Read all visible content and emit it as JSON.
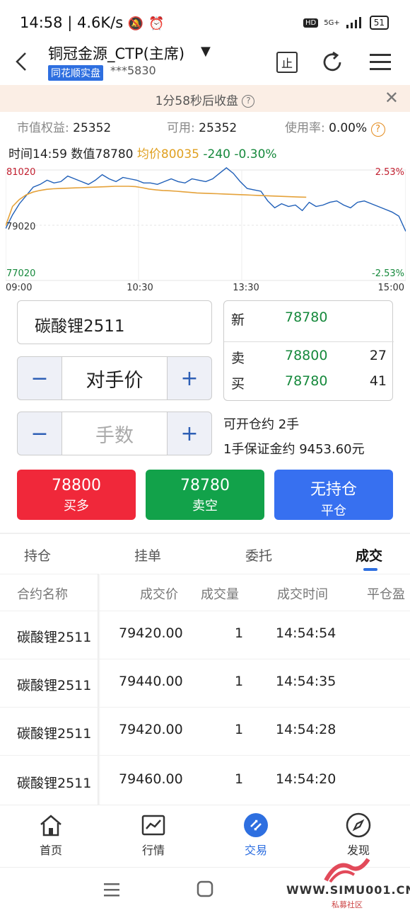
{
  "status_bar": {
    "time": "14:58",
    "speed": "4.6K/s",
    "network": "5G+",
    "hd": "HD",
    "battery": "51"
  },
  "header": {
    "title": "铜冠金源_CTP(主席)",
    "broker_badge": "同花顺实盘",
    "account": "***5830",
    "stop_label": "止"
  },
  "notice": {
    "text": "1分58秒后收盘"
  },
  "account_summary": {
    "equity_label": "市值权益:",
    "equity_value": "25352",
    "available_label": "可用:",
    "available_value": "25352",
    "usage_label": "使用率:",
    "usage_value": "0.00%"
  },
  "chart_info": {
    "time": "时间14:59",
    "value": "数值78780",
    "avg": "均价80035",
    "change": "-240",
    "change_pct": "-0.30%"
  },
  "chart_data": {
    "type": "line",
    "y_ticks_left": [
      "81020",
      "79020",
      "77020"
    ],
    "y_ticks_right": [
      "2.53%",
      "",
      "-2.53%"
    ],
    "x_ticks": [
      "09:00",
      "10:30",
      "13:30",
      "15:00"
    ],
    "ylim": [
      77020,
      81020
    ],
    "series": [
      {
        "values": [
          78900,
          79400,
          79800,
          80100,
          80400,
          80500,
          80650,
          80550,
          80600,
          80800,
          80700,
          80600,
          80500,
          80650,
          80850,
          80700,
          80600,
          80750,
          80700,
          80650,
          80550,
          80550,
          80500,
          80600,
          80700,
          80600,
          80550,
          80700,
          80650,
          80600,
          80700,
          80900,
          81100,
          80900,
          80600,
          80350,
          80300,
          80250,
          79900,
          79650,
          79800,
          79700,
          79750,
          79550,
          79850,
          79700,
          79750,
          79850,
          79900,
          79750,
          79650,
          79850,
          79900,
          79800,
          79700,
          79600,
          79500,
          79350,
          78800
        ]
      },
      {
        "values": [
          79000,
          79700,
          79950,
          80120,
          80220,
          80280,
          80320,
          80340,
          80350,
          80360,
          80370,
          80380,
          80390,
          80400,
          80410,
          80420,
          80430,
          80430,
          80430,
          80420,
          80380,
          80330,
          80300,
          80280,
          80270,
          80250,
          80230,
          80210,
          80190,
          80180,
          80170,
          80160,
          80150,
          80140,
          80130,
          80120,
          80110,
          80100,
          80090,
          80080,
          80070,
          80060,
          80050,
          80040,
          80035
        ]
      }
    ]
  },
  "order_form": {
    "symbol": "碳酸锂2511",
    "price_mode": "对手价",
    "qty_placeholder": "手数",
    "minus": "−",
    "plus": "+"
  },
  "quote": {
    "new_label": "新",
    "new_price": "78780",
    "sell_label": "卖",
    "sell_price": "78800",
    "sell_vol": "27",
    "buy_label": "买",
    "buy_price": "78780",
    "buy_vol": "41"
  },
  "margin": {
    "openable_label": "可开仓约",
    "openable_value": "2手",
    "margin_label": "1手保证金约",
    "margin_value": "9453.60元"
  },
  "actions": {
    "buy_price": "78800",
    "buy_label": "买多",
    "sell_price": "78780",
    "sell_label": "卖空",
    "close_line1": "无持仓",
    "close_label": "平仓",
    "buy_color": "#f0283a",
    "sell_color": "#12a24a",
    "close_color": "#3770f0"
  },
  "tabs": [
    "持仓",
    "挂单",
    "委托",
    "成交"
  ],
  "table": {
    "headers": [
      "合约名称",
      "成交价",
      "成交量",
      "成交时间",
      "平仓盈"
    ],
    "rows": [
      [
        "碳酸锂2511",
        "79420.00",
        "1",
        "14:54:54"
      ],
      [
        "碳酸锂2511",
        "79440.00",
        "1",
        "14:54:35"
      ],
      [
        "碳酸锂2511",
        "79420.00",
        "1",
        "14:54:28"
      ],
      [
        "碳酸锂2511",
        "79460.00",
        "1",
        "14:54:20"
      ]
    ]
  },
  "bottom_nav": [
    "首页",
    "行情",
    "交易",
    "发现"
  ],
  "watermark": {
    "site": "WWW.SIMU001.CN",
    "sub": "私募社区"
  }
}
